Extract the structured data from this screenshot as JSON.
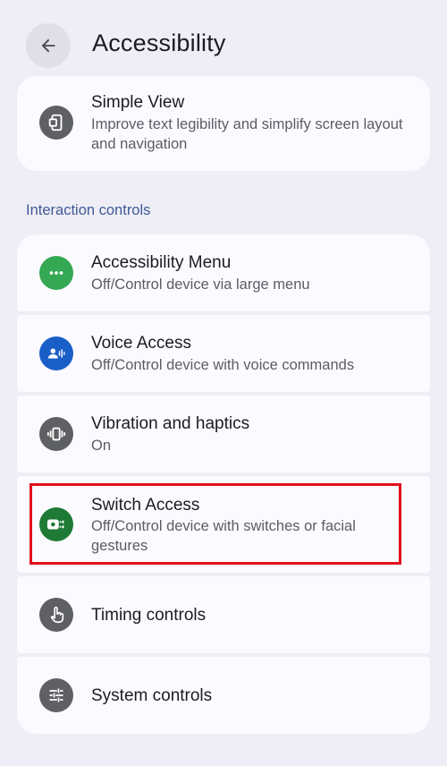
{
  "header": {
    "title": "Accessibility",
    "back_icon": "arrow-back-icon"
  },
  "simple_view": {
    "title": "Simple View",
    "subtitle": "Improve text legibility and simplify screen layout and navigation",
    "icon": "simple-view-icon"
  },
  "section": {
    "title": "Interaction controls"
  },
  "items": [
    {
      "title": "Accessibility Menu",
      "subtitle": "Off/Control device via large menu",
      "icon": "more-horizontal-icon",
      "icon_color": "#34a853"
    },
    {
      "title": "Voice Access",
      "subtitle": "Off/Control device with voice commands",
      "icon": "voice-access-icon",
      "icon_color": "#1a5fc8"
    },
    {
      "title": "Vibration and haptics",
      "subtitle": "On",
      "icon": "vibration-icon",
      "icon_color": "#5f6063"
    },
    {
      "title": "Switch Access",
      "subtitle": "Off/Control device with switches or facial gestures",
      "icon": "switch-access-icon",
      "icon_color": "#1e7a34"
    },
    {
      "title": "Timing controls",
      "subtitle": "",
      "icon": "touch-icon",
      "icon_color": "#5f6063"
    },
    {
      "title": "System controls",
      "subtitle": "",
      "icon": "tune-icon",
      "icon_color": "#5f6063"
    }
  ],
  "colors": {
    "background": "#efedf5",
    "card": "#fbfaff",
    "section_header": "#3d5a98",
    "highlight": "#e0101c"
  }
}
